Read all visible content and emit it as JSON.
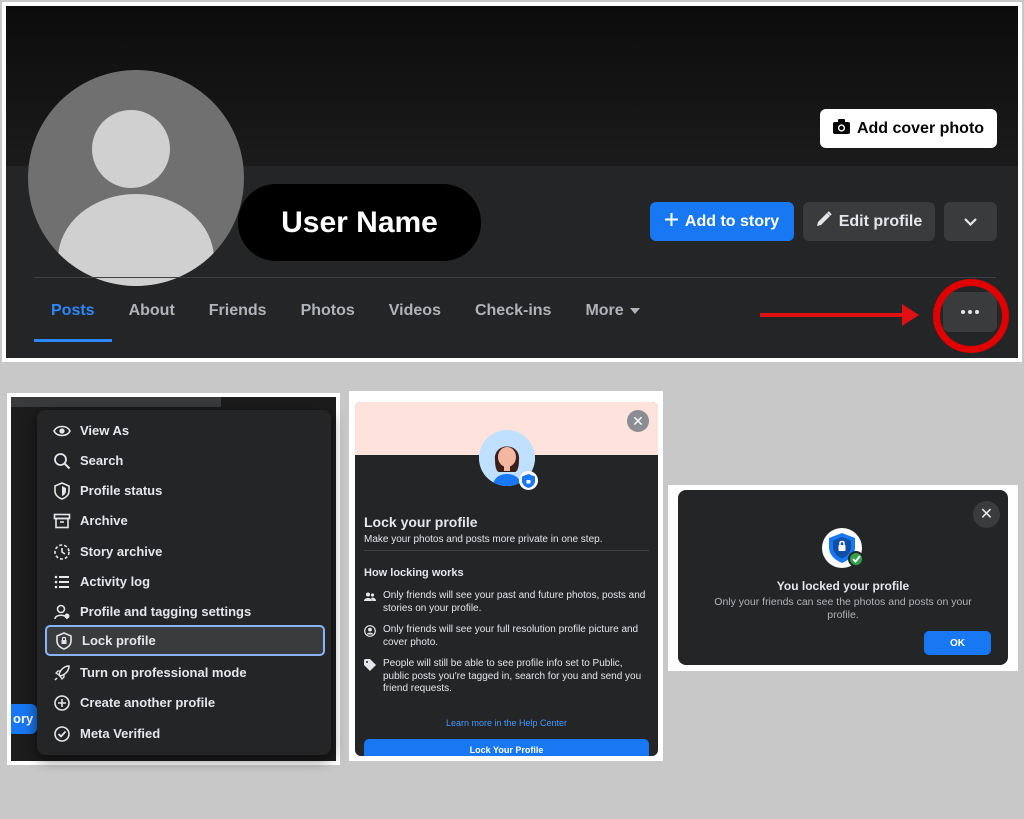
{
  "profile": {
    "user_name": "User Name",
    "add_cover_photo": "Add cover photo",
    "add_to_story": "Add to story",
    "edit_profile": "Edit profile",
    "tabs": [
      {
        "label": "Posts"
      },
      {
        "label": "About"
      },
      {
        "label": "Friends"
      },
      {
        "label": "Photos"
      },
      {
        "label": "Videos"
      },
      {
        "label": "Check-ins"
      },
      {
        "label": "More"
      }
    ]
  },
  "menu": {
    "story_fragment": "ory",
    "items": [
      {
        "label": "View As",
        "icon": "eye-icon"
      },
      {
        "label": "Search",
        "icon": "search-icon"
      },
      {
        "label": "Profile status",
        "icon": "shield-icon"
      },
      {
        "label": "Archive",
        "icon": "archive-icon"
      },
      {
        "label": "Story archive",
        "icon": "clock-icon"
      },
      {
        "label": "Activity log",
        "icon": "list-icon"
      },
      {
        "label": "Profile and tagging settings",
        "icon": "user-gear-icon"
      },
      {
        "label": "Lock profile",
        "icon": "lock-shield-icon"
      },
      {
        "label": "Turn on professional mode",
        "icon": "rocket-icon"
      },
      {
        "label": "Create another profile",
        "icon": "plus-circle-icon"
      },
      {
        "label": "Meta Verified",
        "icon": "verified-icon"
      }
    ]
  },
  "lock_dialog": {
    "title": "Lock your profile",
    "subtitle": "Make your photos and posts more private in one step.",
    "how_heading": "How locking works",
    "items": [
      {
        "text": "Only friends will see your past and future photos, posts and stories on your profile."
      },
      {
        "text": "Only friends will see your full resolution profile picture and cover photo."
      },
      {
        "text": "People will still be able to see profile info set to Public, public posts you're tagged in, search for you and send you friend requests."
      }
    ],
    "learn_more": "Learn more in the Help Center",
    "button": "Lock Your Profile"
  },
  "locked_dialog": {
    "title": "You locked your profile",
    "subtitle": "Only your friends can see the photos and posts on your profile.",
    "ok": "OK"
  },
  "colors": {
    "accent": "#1877f2",
    "highlight_ring": "#e00000",
    "dark_surface": "#242526"
  }
}
